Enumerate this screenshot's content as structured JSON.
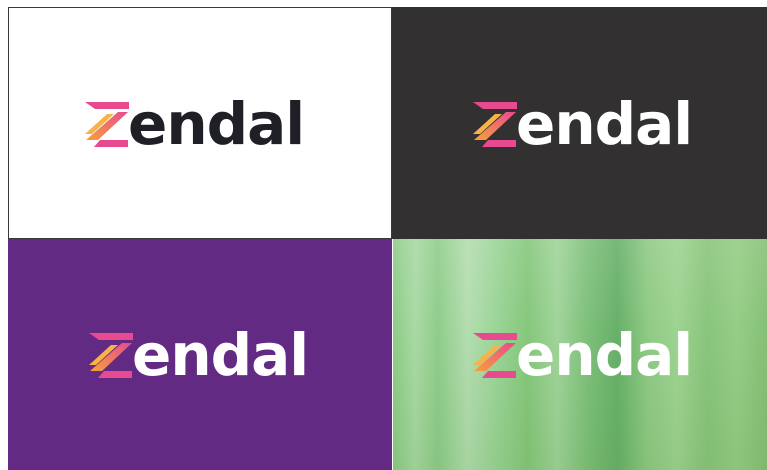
{
  "brand": {
    "wordmark": "endal",
    "mark_letter": "Z",
    "colors": {
      "mark_pink": "#e84a8f",
      "mark_orange": "#f6a13a",
      "text_dark": "#1f1f26",
      "text_light": "#ffffff"
    }
  },
  "panels": [
    {
      "variant": "white-background",
      "background": "#ffffff",
      "wordmark_color": "#1f1f26"
    },
    {
      "variant": "dark-gray-background",
      "background": "#323031",
      "wordmark_color": "#ffffff"
    },
    {
      "variant": "purple-background",
      "background": "#632a83",
      "wordmark_color": "#ffffff"
    },
    {
      "variant": "green-photo-background",
      "background": "#8fca84",
      "wordmark_color": "#ffffff"
    }
  ]
}
